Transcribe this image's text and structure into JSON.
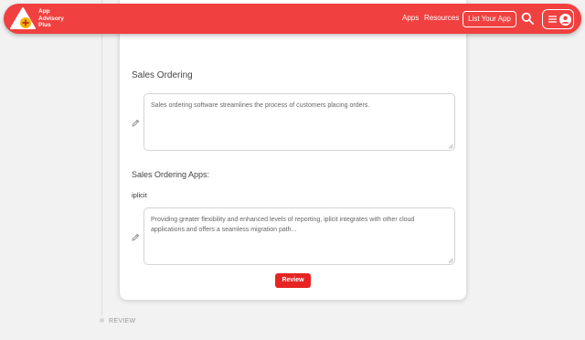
{
  "brand": {
    "line1": "App",
    "line2": "Advisory",
    "line3": "Plus"
  },
  "nav": {
    "apps": "Apps",
    "resources": "Resources",
    "list_app": "List Your App",
    "search_icon": "search-icon",
    "menu_icon": "hamburger-icon",
    "user_icon": "user-circle-icon"
  },
  "content": {
    "section_title": "Sales Ordering",
    "description": "Sales ordering software streamlines the process of customers placing orders.",
    "apps_title": "Sales Ordering Apps:",
    "app_name": "iplicit",
    "app_description": "Providing greater flexibility and enhanced levels of reporting, iplicit integrates with other cloud applications and offers a seamless migration path...",
    "review_button": "Review"
  },
  "timeline": {
    "step_label": "REVIEW"
  },
  "colors": {
    "brand_red": "#f0403f",
    "button_red": "#e62424",
    "page_bg": "#f2f2f2"
  }
}
